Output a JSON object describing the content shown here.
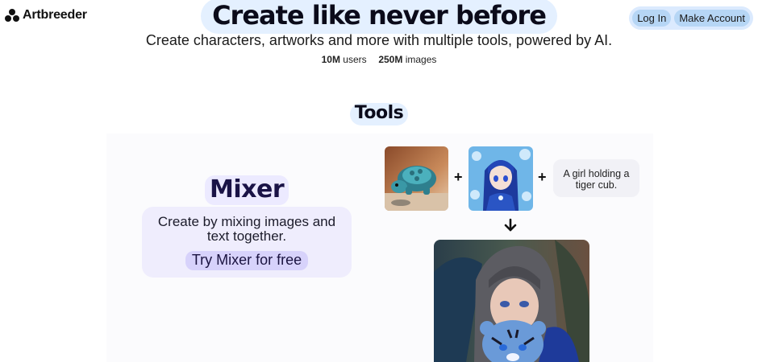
{
  "header": {
    "brand": "Artbreeder",
    "login_label": "Log In",
    "signup_label": "Make Account"
  },
  "hero": {
    "title": "Create like never before",
    "subtitle": "Create characters, artworks and more with multiple tools, powered by AI.",
    "stats": [
      {
        "value": "10M",
        "label": "users"
      },
      {
        "value": "250M",
        "label": "images"
      }
    ]
  },
  "tools": {
    "heading": "Tools",
    "mixer": {
      "title": "Mixer",
      "description": "Create by mixing images and text together.",
      "cta_label": "Try Mixer for free",
      "inputs": {
        "plus_1": "+",
        "plus_2": "+",
        "prompt_text": "A girl holding a tiger cub."
      }
    }
  },
  "icons": [
    "artbreeder-logo-icon",
    "plus-icon",
    "arrow-down-icon"
  ],
  "colors": {
    "hero_highlight": "#e4f0ff",
    "auth_pill": "#b6d6f5",
    "mixer_card": "#efedfd",
    "mixer_button": "#d7d2fb"
  }
}
